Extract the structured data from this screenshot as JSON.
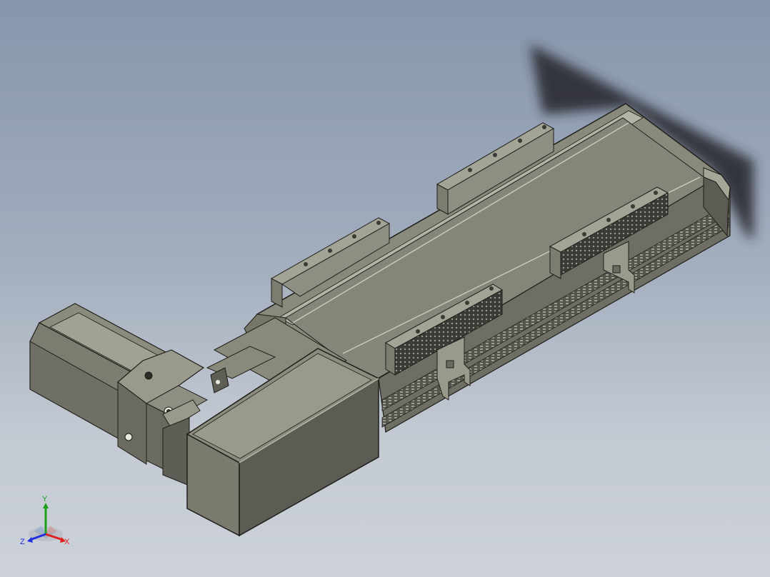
{
  "viewport": {
    "background_top": "#8796ad",
    "background_bottom": "#cdd2d9",
    "model_color": "#8a8a7c"
  },
  "triad": {
    "x_label": "X",
    "y_label": "Y",
    "z_label": "Z",
    "x_color": "#e02020",
    "y_color": "#1aa01a",
    "z_color": "#2030e0"
  }
}
